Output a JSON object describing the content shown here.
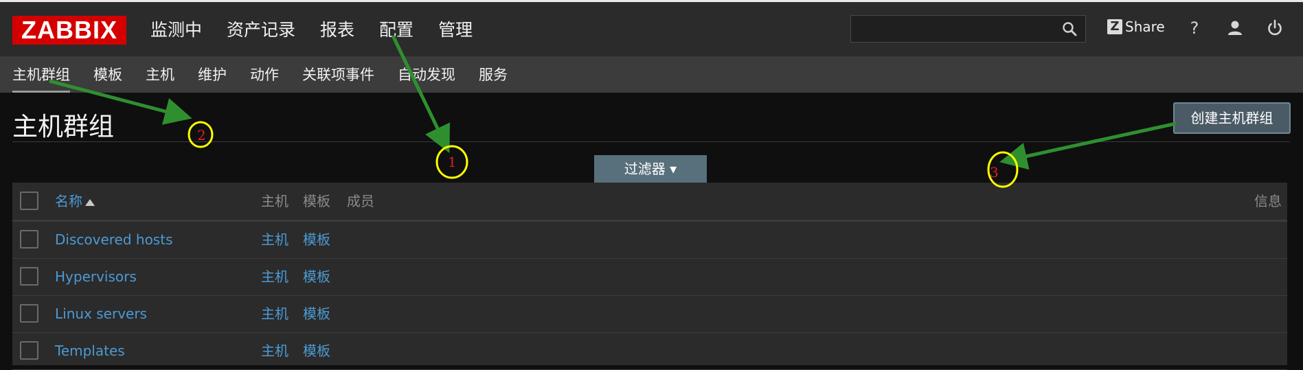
{
  "logo": "ZABBIX",
  "main_nav": [
    "监测中",
    "资产记录",
    "报表",
    "配置",
    "管理"
  ],
  "header": {
    "search_placeholder": "",
    "share_label": "Share",
    "share_icon": "Z",
    "help_label": "?"
  },
  "sub_nav": [
    "主机群组",
    "模板",
    "主机",
    "维护",
    "动作",
    "关联项事件",
    "自动发现",
    "服务"
  ],
  "page": {
    "title": "主机群组",
    "create_button": "创建主机群组",
    "filter_label": "过滤器 ▾"
  },
  "table": {
    "headers": {
      "name": "名称",
      "hosts": "主机",
      "templates": "模板",
      "members": "成员",
      "info": "信息"
    },
    "rows": [
      {
        "name": "Discovered hosts",
        "hosts": "主机",
        "templates": "模板"
      },
      {
        "name": "Hypervisors",
        "hosts": "主机",
        "templates": "模板"
      },
      {
        "name": "Linux servers",
        "hosts": "主机",
        "templates": "模板"
      },
      {
        "name": "Templates",
        "hosts": "主机",
        "templates": "模板"
      }
    ]
  },
  "annotations": {
    "labels": [
      "1",
      "2",
      "3"
    ],
    "arrow_color": "#2f8f2f",
    "circle_color": "#ffff00",
    "number_color": "#e02020"
  },
  "colors": {
    "logo_red": "#d40000",
    "link_blue": "#4c9ad4",
    "create_button": "#4b5b66",
    "filter_tab": "#58707c"
  }
}
